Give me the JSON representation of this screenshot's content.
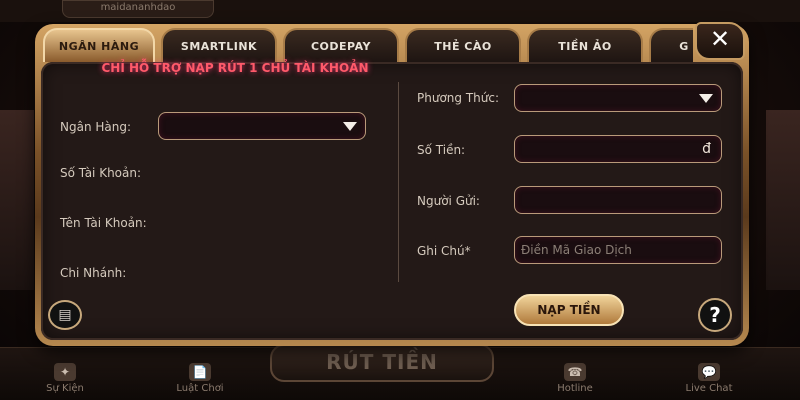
{
  "background": {
    "account": "maidananhdao",
    "bottom_nav": [
      {
        "label": "Sự Kiện",
        "icon": "event-icon"
      },
      {
        "label": "Luật Chơi",
        "icon": "rules-icon"
      },
      {
        "label": "Hotline",
        "icon": "phone-icon"
      },
      {
        "label": "Live Chat",
        "icon": "chat-icon"
      }
    ],
    "rut_tien": "RÚT TIỀN"
  },
  "tabs": [
    {
      "label": "NGÂN HÀNG",
      "active": true
    },
    {
      "label": "SMARTLINK",
      "active": false
    },
    {
      "label": "CODEPAY",
      "active": false
    },
    {
      "label": "THẺ CÀO",
      "active": false
    },
    {
      "label": "TIỀN ẢO",
      "active": false
    },
    {
      "label": "G",
      "active": false
    }
  ],
  "close_icon": "close-icon",
  "notice": "CHỈ HỖ TRỢ NẠP RÚT 1 CHỦ TÀI KHOẢN",
  "left": {
    "bank_label": "Ngân Hàng:",
    "account_number_label": "Số Tài Khoản:",
    "account_name_label": "Tên Tài Khoản:",
    "branch_label": "Chi Nhánh:"
  },
  "right": {
    "method_label": "Phương Thức:",
    "amount_label": "Số Tiền:",
    "amount_unit": "đ",
    "sender_label": "Người Gửi:",
    "note_label": "Ghi Chú*",
    "note_placeholder": "Điền Mã Giao Dịch"
  },
  "submit": "NẠP TIỀN",
  "colors": {
    "accent_gold": "#d4a464",
    "notice_pink": "#ff5a6a",
    "panel_bg": "#231917"
  }
}
